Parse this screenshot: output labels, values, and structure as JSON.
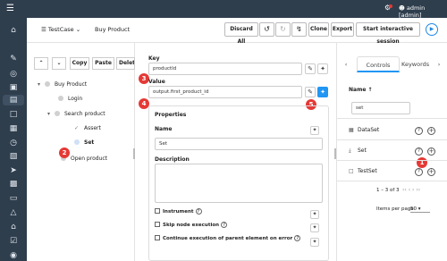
{
  "topbar": {
    "user_label": "admin [admin]"
  },
  "header": {
    "type_label": "TestCase",
    "name_label": "Buy Product",
    "discard_label": "Discard All",
    "clone_label": "Clone",
    "export_label": "Export",
    "start_label": "Start interactive session"
  },
  "tree": {
    "copy_label": "Copy",
    "paste_label": "Paste",
    "delete_label": "Delete",
    "nodes": {
      "root": "Buy Product",
      "login": "Login",
      "search": "Search product",
      "assert": "Assert",
      "set": "Set",
      "open": "Open product"
    }
  },
  "props": {
    "key_label": "Key",
    "key_value": "productId",
    "value_label": "Value",
    "value_value": "output.first_product_id",
    "properties_title": "Properties",
    "name_label": "Name",
    "name_value": "Set",
    "description_label": "Description",
    "instrument_label": "Instrument",
    "skip_label": "Skip node execution",
    "continue_label": "Continue execution of parent element on error"
  },
  "right": {
    "tab_controls": "Controls",
    "tab_keywords": "Keywords",
    "col_name": "Name",
    "filter_value": "set",
    "items": [
      "DataSet",
      "Set",
      "TestSet"
    ],
    "pagination": "1 – 3 of 3",
    "items_per_page_label": "Items per page",
    "items_per_page_value": "50"
  },
  "markers": [
    "1",
    "2",
    "3",
    "4",
    "5"
  ],
  "colors": {
    "nav_bg": "#2f3e4d",
    "accent": "#2196f3",
    "marker": "#e53935"
  }
}
